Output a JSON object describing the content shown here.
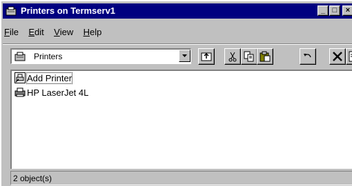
{
  "window": {
    "title": "Printers on Termserv1",
    "controls": {
      "minimize": "_",
      "maximize": "□",
      "close": "×"
    }
  },
  "menu": {
    "items": [
      {
        "accel": "F",
        "rest": "ile"
      },
      {
        "accel": "E",
        "rest": "dit"
      },
      {
        "accel": "V",
        "rest": "iew"
      },
      {
        "accel": "H",
        "rest": "elp"
      }
    ]
  },
  "toolbar": {
    "location": "Printers",
    "buttons": [
      "up-one-level-icon",
      "cut-icon",
      "copy-icon",
      "paste-icon",
      "undo-icon",
      "delete-icon",
      "properties-icon"
    ]
  },
  "items": [
    {
      "label": "Add Printer",
      "icon": "add-printer-icon"
    },
    {
      "label": "HP LaserJet 4L",
      "icon": "printer-icon"
    }
  ],
  "status": {
    "text": "2 object(s)"
  }
}
